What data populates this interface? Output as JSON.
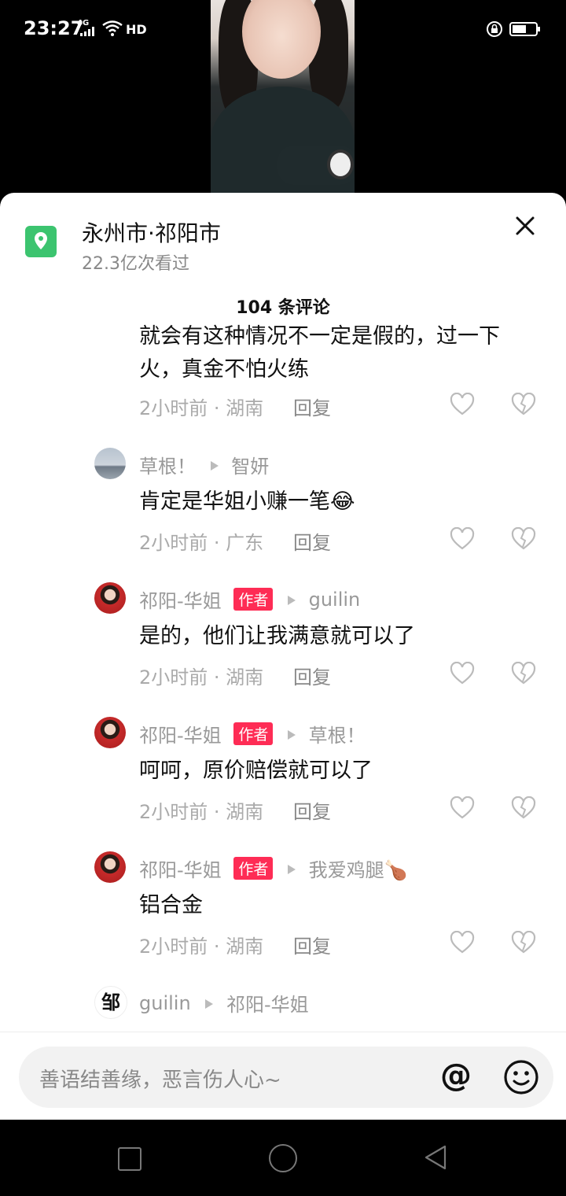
{
  "status_bar": {
    "time": "23:27",
    "network": "4G",
    "hd": "HD"
  },
  "location": {
    "title": "永州市·祁阳市",
    "subtitle": "22.3亿次看过"
  },
  "comment_count": "104 条评论",
  "comments": [
    {
      "text": "就会有这种情况不一定是假的，过一下火，真金不怕火练",
      "time": "2小时前 · 湖南",
      "reply": "回复"
    },
    {
      "name": "草根！",
      "reply_to": "智妍",
      "text": "肯定是华姐小赚一笔😂",
      "time": "2小时前 · 广东",
      "reply": "回复",
      "avatar": "sky"
    },
    {
      "name": "祁阳-华姐",
      "tag": "作者",
      "reply_to": "guilin",
      "text": "是的，他们让我满意就可以了",
      "time": "2小时前 · 湖南",
      "reply": "回复",
      "avatar": "red"
    },
    {
      "name": "祁阳-华姐",
      "tag": "作者",
      "reply_to": "草根！",
      "text": "呵呵，原价赔偿就可以了",
      "time": "2小时前 · 湖南",
      "reply": "回复",
      "avatar": "red"
    },
    {
      "name": "祁阳-华姐",
      "tag": "作者",
      "reply_to": "我爱鸡腿🍗",
      "text": "铝合金",
      "time": "2小时前 · 湖南",
      "reply": "回复",
      "avatar": "red"
    },
    {
      "name": "guilin",
      "reply_to": "祁阳-华姐",
      "avatar": "char",
      "avatar_char": "邹"
    }
  ],
  "input": {
    "placeholder": "善语结善缘，恶言伤人心~",
    "at": "@"
  }
}
